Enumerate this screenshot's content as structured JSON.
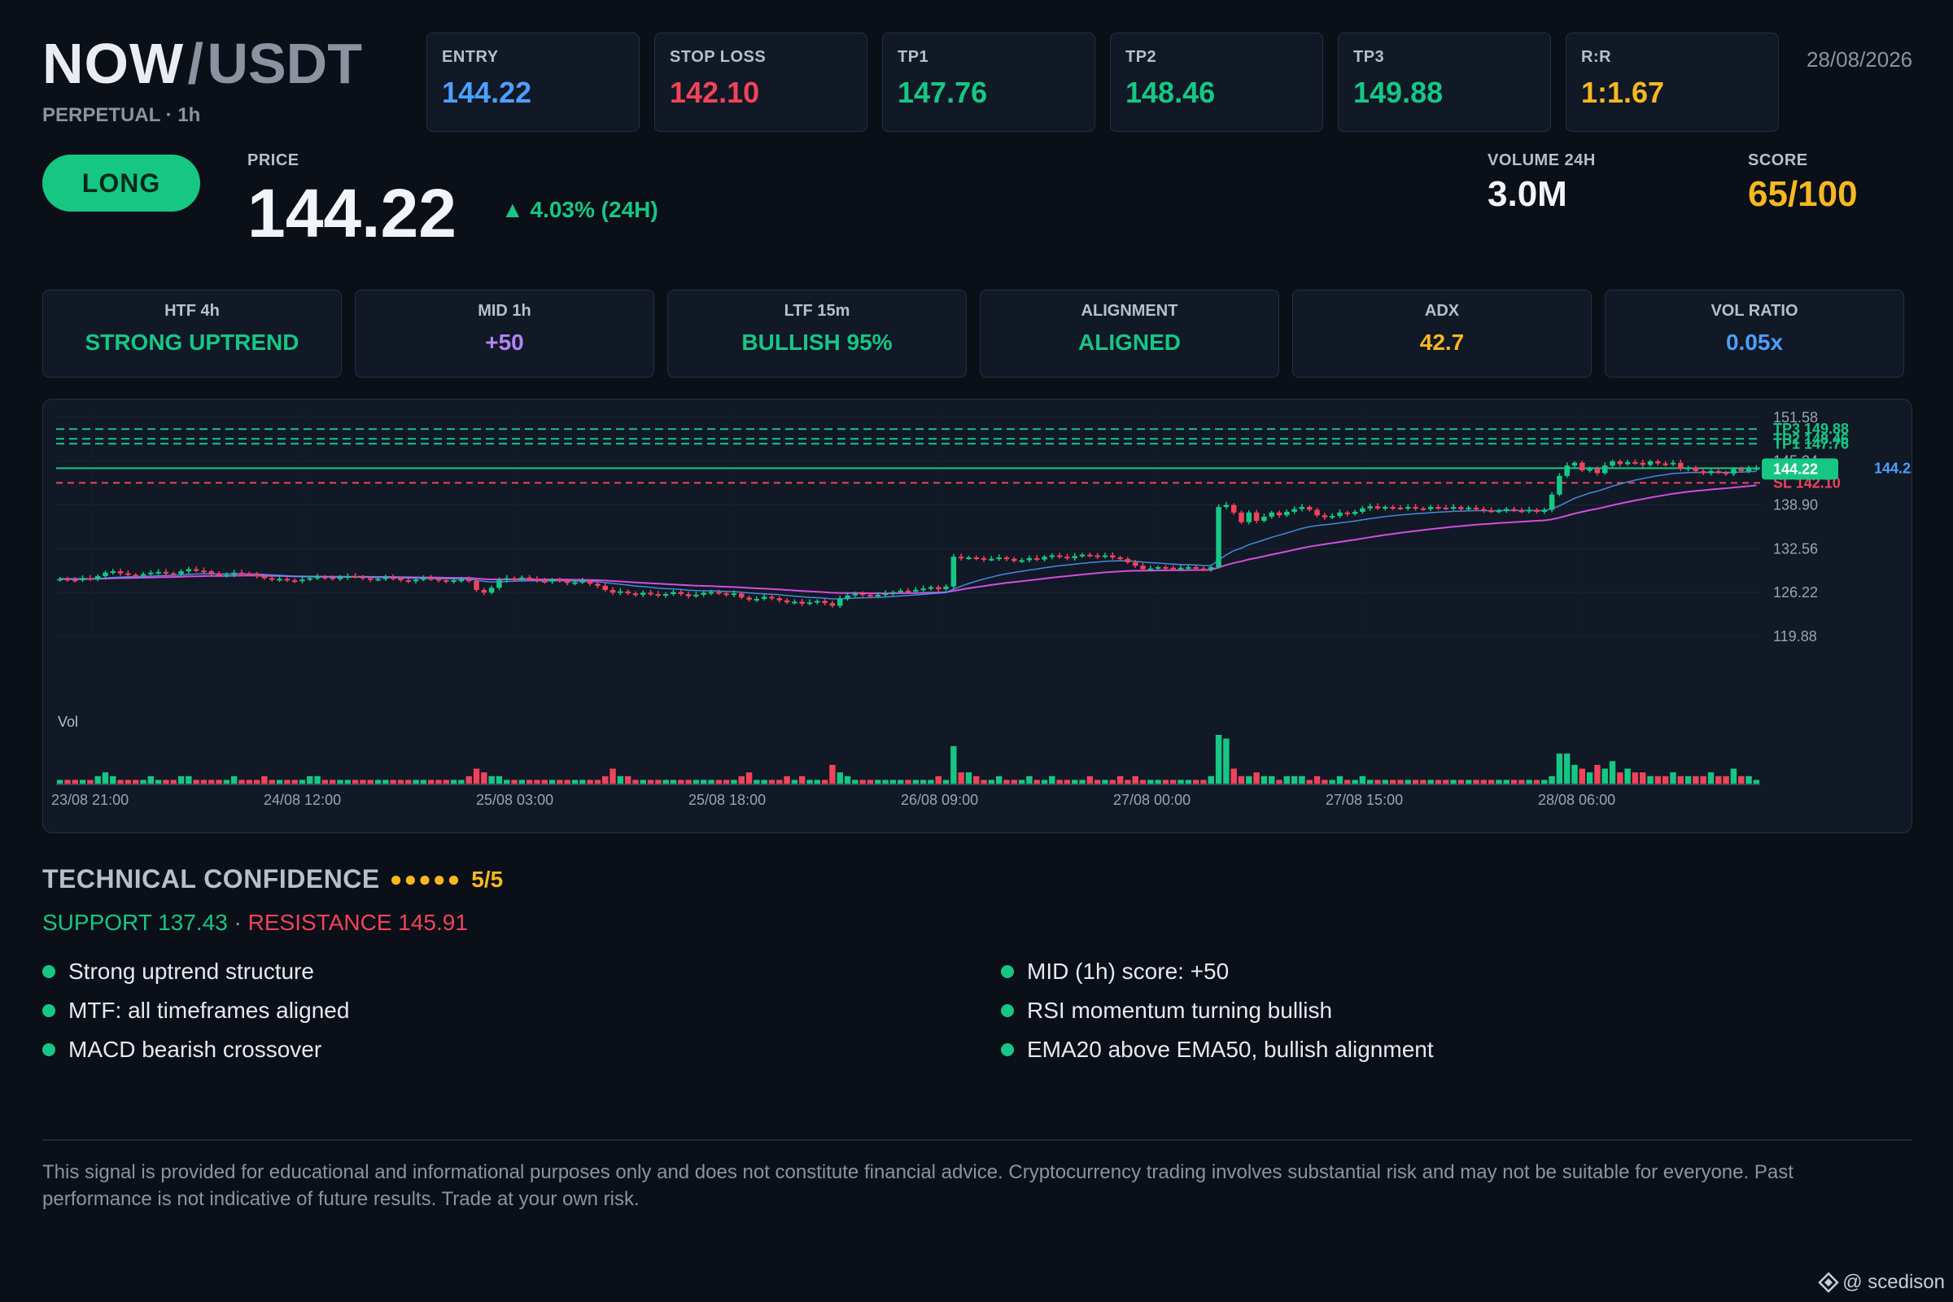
{
  "header": {
    "base": "NOW",
    "separator": "/",
    "quote": "USDT",
    "subtitle": "PERPETUAL · 1h",
    "date": "28/08/2026"
  },
  "levels": [
    {
      "label": "ENTRY",
      "value": "144.22",
      "color": "#4c9ffe"
    },
    {
      "label": "STOP LOSS",
      "value": "142.10",
      "color": "#f0435a"
    },
    {
      "label": "TP1",
      "value": "147.76",
      "color": "#16c784"
    },
    {
      "label": "TP2",
      "value": "148.46",
      "color": "#16c784"
    },
    {
      "label": "TP3",
      "value": "149.88",
      "color": "#16c784"
    },
    {
      "label": "R:R",
      "value": "1:1.67",
      "color": "#f5b821"
    }
  ],
  "direction": "LONG",
  "price": {
    "label": "PRICE",
    "value": "144.22",
    "change_arrow": "▲",
    "change": "4.03% (24H)"
  },
  "volume": {
    "label": "VOLUME 24H",
    "value": "3.0M"
  },
  "score": {
    "label": "SCORE",
    "value": "65/100"
  },
  "timeframes": [
    {
      "label": "HTF 4h",
      "value": "STRONG UPTREND",
      "color": "#16c784"
    },
    {
      "label": "MID 1h",
      "value": "+50",
      "color": "#b085f5"
    },
    {
      "label": "LTF 15m",
      "value": "BULLISH 95%",
      "color": "#16c784"
    },
    {
      "label": "ALIGNMENT",
      "value": "ALIGNED",
      "color": "#16c784"
    },
    {
      "label": "ADX",
      "value": "42.7",
      "color": "#f5b821"
    },
    {
      "label": "VOL RATIO",
      "value": "0.05x",
      "color": "#4c9ffe"
    }
  ],
  "chart_data": {
    "type": "candlestick",
    "y_ticks": [
      151.58,
      145.24,
      138.9,
      132.56,
      126.22,
      119.88
    ],
    "ylim": [
      119.88,
      151.58
    ],
    "x_ticks": [
      "23/08 21:00",
      "24/08 12:00",
      "25/08 03:00",
      "25/08 18:00",
      "26/08 09:00",
      "27/08 00:00",
      "27/08 15:00",
      "28/08 06:00"
    ],
    "volume_label": "Vol",
    "levels": [
      {
        "name": "TP3",
        "value": 149.88,
        "label": "TP3 149.88",
        "color": "#16c784"
      },
      {
        "name": "TP2",
        "value": 148.46,
        "label": "TP2 148.46",
        "color": "#16c784"
      },
      {
        "name": "TP1",
        "value": 147.76,
        "label": "TP1 147.76",
        "color": "#16c784"
      },
      {
        "name": "Entry",
        "value": 144.22,
        "label": "144.22",
        "color": "#4c9ffe"
      },
      {
        "name": "SL",
        "value": 142.1,
        "label": "SL 142.10",
        "color": "#f0435a"
      }
    ],
    "current_price": {
      "value": 144.22,
      "label": "144.22"
    },
    "close_series": [
      128.2,
      128.1,
      128.0,
      128.3,
      128.2,
      128.6,
      129.1,
      129.3,
      129.0,
      128.8,
      128.7,
      128.9,
      129.1,
      129.2,
      129.0,
      128.9,
      129.3,
      129.6,
      129.4,
      129.3,
      129.0,
      128.7,
      128.8,
      129.1,
      129.0,
      128.9,
      128.6,
      128.3,
      128.1,
      128.2,
      128.0,
      127.9,
      128.1,
      128.3,
      128.5,
      128.4,
      128.2,
      128.4,
      128.6,
      128.5,
      128.3,
      128.1,
      128.2,
      128.4,
      128.3,
      128.0,
      127.9,
      128.1,
      128.3,
      128.2,
      128.0,
      127.8,
      128.0,
      128.1,
      127.9,
      126.6,
      126.2,
      126.9,
      128.0,
      128.3,
      128.1,
      128.4,
      128.2,
      127.9,
      127.8,
      128.1,
      127.9,
      127.6,
      127.7,
      127.9,
      127.5,
      127.2,
      126.6,
      126.2,
      126.4,
      126.1,
      125.9,
      126.2,
      126.0,
      125.8,
      126.0,
      126.3,
      126.0,
      125.7,
      125.9,
      126.2,
      126.3,
      126.1,
      125.9,
      126.1,
      125.5,
      125.2,
      125.3,
      125.6,
      125.4,
      125.1,
      124.8,
      124.9,
      124.6,
      124.8,
      125.0,
      124.7,
      124.3,
      125.4,
      125.8,
      126.1,
      125.9,
      125.7,
      125.9,
      126.1,
      126.3,
      126.5,
      126.4,
      126.6,
      126.8,
      127.0,
      126.7,
      127.1,
      131.4,
      131.2,
      131.3,
      131.2,
      131.0,
      131.1,
      131.3,
      131.1,
      130.8,
      130.9,
      131.2,
      131.0,
      131.4,
      131.6,
      131.4,
      131.2,
      131.5,
      131.7,
      131.6,
      131.4,
      131.6,
      131.3,
      131.1,
      130.6,
      130.1,
      129.6,
      129.7,
      129.9,
      129.8,
      129.6,
      129.8,
      129.9,
      129.7,
      129.6,
      129.9,
      138.6,
      138.9,
      137.8,
      136.4,
      137.8,
      136.6,
      137.2,
      137.8,
      137.4,
      137.9,
      138.3,
      138.6,
      138.2,
      137.4,
      137.1,
      137.3,
      137.8,
      137.6,
      137.9,
      138.4,
      138.7,
      138.4,
      138.6,
      138.5,
      138.4,
      138.6,
      138.4,
      138.3,
      138.6,
      138.5,
      138.4,
      138.6,
      138.3,
      138.5,
      138.3,
      138.1,
      138.0,
      138.1,
      138.3,
      138.1,
      138.0,
      138.2,
      137.9,
      138.2,
      140.4,
      143.1,
      144.6,
      145.0,
      143.9,
      144.1,
      143.5,
      144.6,
      145.2,
      144.8,
      145.1,
      145.0,
      144.7,
      145.2,
      144.9,
      144.8,
      145.0,
      144.1,
      144.3,
      143.8,
      143.5,
      143.8,
      143.6,
      143.4,
      144.1,
      143.8,
      144.2,
      144.22
    ],
    "volume_series": [
      1,
      1,
      1,
      1,
      1,
      2,
      3,
      2,
      1,
      1,
      1,
      1,
      2,
      1,
      1,
      1,
      2,
      2,
      1,
      1,
      1,
      1,
      1,
      2,
      1,
      1,
      1,
      2,
      1,
      1,
      1,
      1,
      1,
      2,
      2,
      1,
      1,
      1,
      1,
      1,
      1,
      1,
      1,
      1,
      1,
      1,
      1,
      1,
      1,
      1,
      1,
      1,
      1,
      1,
      2,
      4,
      3,
      2,
      2,
      1,
      1,
      1,
      1,
      1,
      1,
      1,
      1,
      1,
      1,
      1,
      1,
      1,
      2,
      4,
      2,
      2,
      1,
      1,
      1,
      1,
      1,
      1,
      1,
      1,
      1,
      1,
      1,
      1,
      1,
      1,
      2,
      3,
      1,
      1,
      1,
      1,
      2,
      1,
      2,
      1,
      1,
      1,
      5,
      3,
      2,
      1,
      1,
      1,
      1,
      1,
      1,
      1,
      1,
      1,
      1,
      1,
      2,
      1,
      10,
      3,
      3,
      2,
      1,
      1,
      2,
      1,
      1,
      1,
      2,
      1,
      1,
      2,
      1,
      1,
      1,
      1,
      2,
      1,
      1,
      1,
      2,
      1,
      2,
      1,
      1,
      1,
      1,
      1,
      1,
      1,
      1,
      1,
      2,
      13,
      12,
      4,
      2,
      2,
      3,
      2,
      2,
      1,
      2,
      2,
      2,
      1,
      2,
      1,
      1,
      2,
      1,
      1,
      2,
      1,
      1,
      1,
      1,
      1,
      1,
      1,
      1,
      1,
      1,
      1,
      1,
      1,
      1,
      1,
      1,
      1,
      1,
      1,
      1,
      1,
      1,
      1,
      1,
      2,
      8,
      8,
      5,
      4,
      3,
      5,
      4,
      6,
      3,
      4,
      3,
      3,
      2,
      2,
      2,
      3,
      2,
      2,
      2,
      2,
      3,
      2,
      2,
      4,
      2,
      2,
      1
    ]
  },
  "confidence": {
    "title": "TECHNICAL CONFIDENCE",
    "dots": "●●●●●",
    "score": "5/5",
    "support": "SUPPORT 137.43",
    "sep": " · ",
    "resistance": "RESISTANCE 145.91"
  },
  "reasons_left": [
    "Strong uptrend structure",
    "MTF: all timeframes aligned",
    "MACD bearish crossover"
  ],
  "reasons_right": [
    "MID (1h) score: +50",
    "RSI momentum turning bullish",
    "EMA20 above EMA50, bullish alignment"
  ],
  "disclaimer": "This signal is provided for educational and informational purposes only and does not constitute financial advice. Cryptocurrency trading involves substantial risk and may not be suitable for everyone. Past performance is not indicative of future results. Trade at your own risk.",
  "watermark": "@ scedison",
  "colors": {
    "up": "#16c784",
    "down": "#f0435a",
    "ema20": "#4c9ffe",
    "ema50": "#d24fdc",
    "gold": "#f5b821"
  }
}
